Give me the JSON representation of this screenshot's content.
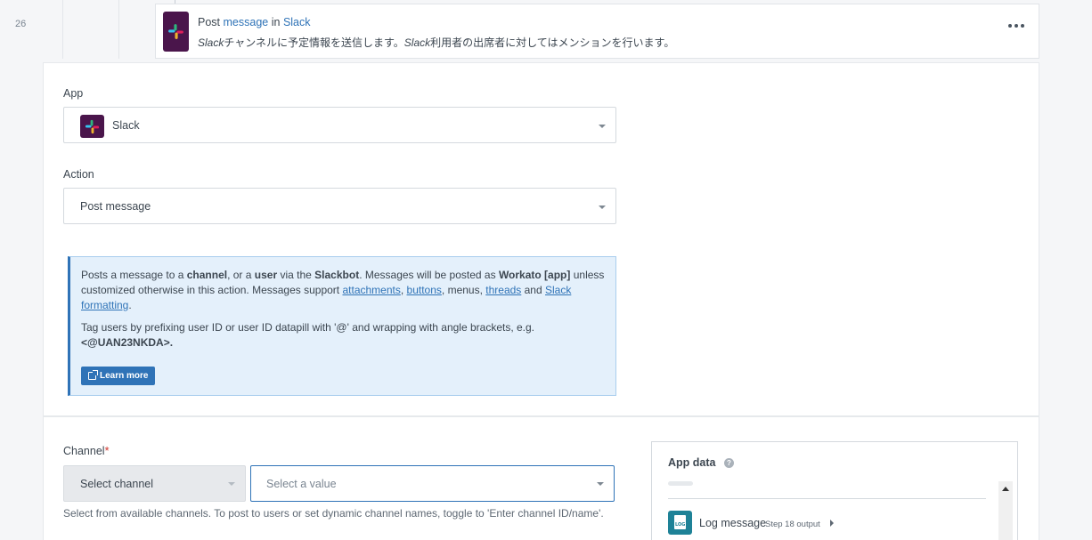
{
  "step": {
    "number": "26",
    "title_prefix": "Post",
    "title_action": "message",
    "title_in": "in",
    "title_app": "Slack",
    "description_em": "Slack",
    "description_1": "チャンネルに予定情報を送信します。",
    "description_em2": "Slack",
    "description_2": "利用者の出席者に対してはメンションを行います。"
  },
  "app_field": {
    "label": "App",
    "value": "Slack"
  },
  "action_field": {
    "label": "Action",
    "value": "Post message"
  },
  "info": {
    "p1": [
      "Posts a message to a ",
      "channel",
      ", or a ",
      "user",
      " via the ",
      "Slackbot",
      ". Messages will be posted as ",
      "Workato [app]",
      " unless customized otherwise in this action. Messages support "
    ],
    "links": [
      "attachments",
      "buttons",
      "threads",
      "Slack formatting"
    ],
    "sep_comma": ", ",
    "sep_menus": ", menus, ",
    "sep_and": " and ",
    "end": ".",
    "p2": "Tag users by prefixing user ID or user ID datapill with '@' and wrapping with angle brackets, e.g.",
    "p2_code": "<@UAN23NKDA>.",
    "learn_more": "Learn more"
  },
  "channel_field": {
    "label": "Channel",
    "required_mark": "*",
    "mode": "Select channel",
    "placeholder": "Select a value",
    "hint": "Select from available channels. To post to users or set dynamic channel names, toggle to 'Enter channel ID/name'."
  },
  "app_data": {
    "title": "App data",
    "help": "?",
    "item_label": "Log message",
    "item_meta": "Step 18 output"
  },
  "icons": {
    "slack": "slack-logo-icon",
    "more": "more-horizontal-icon",
    "external": "external-link-icon",
    "log": "log-document-icon"
  },
  "colors": {
    "accent": "#2f73b7",
    "slack_bg": "#4a154b",
    "info_bg": "#e4f0fb",
    "log_icon": "#1e8297"
  }
}
